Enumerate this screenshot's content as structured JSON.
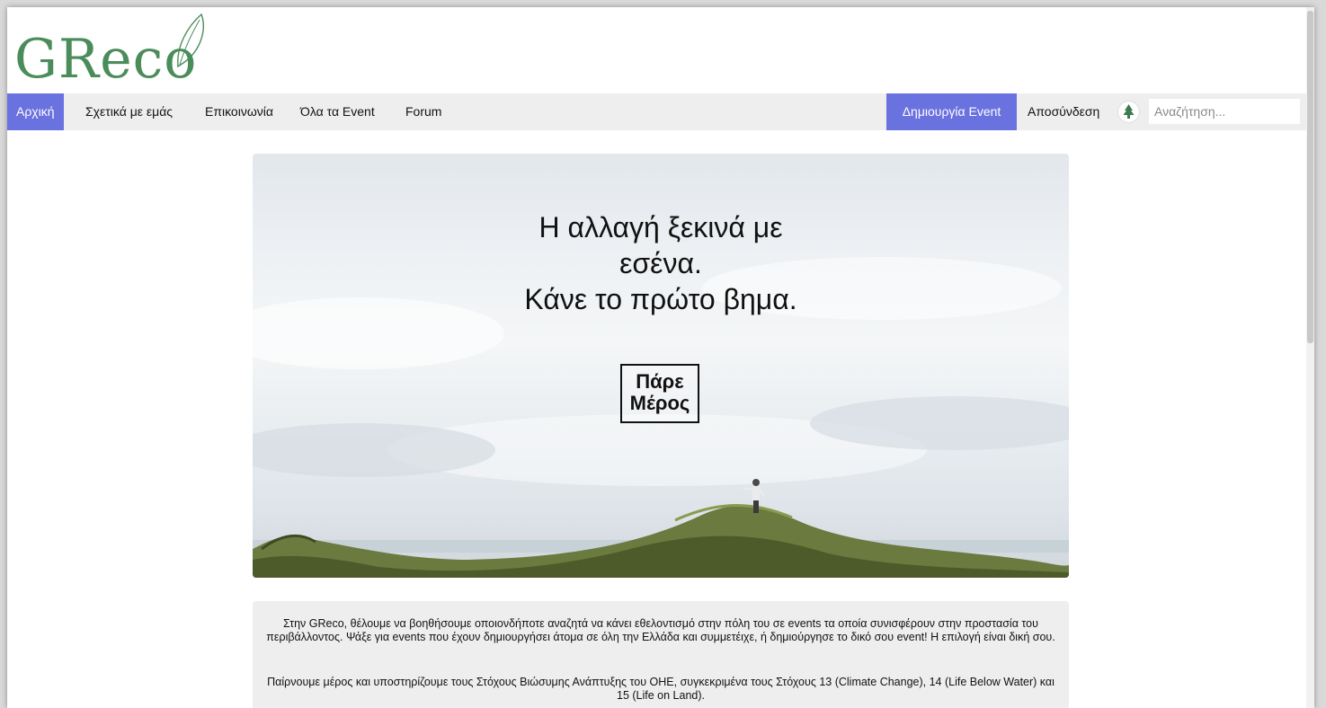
{
  "logo": {
    "text": "GReco"
  },
  "nav": {
    "items": [
      {
        "label": "Αρχική",
        "active": true
      },
      {
        "label": "Σχετικά με εμάς",
        "active": false
      },
      {
        "label": "Επικοινωνία",
        "active": false
      },
      {
        "label": "Όλα τα Event",
        "active": false
      },
      {
        "label": "Forum",
        "active": false
      }
    ],
    "create_event": "Δημιουργία Event",
    "logout": "Αποσύνδεση",
    "user_icon": "tree-icon",
    "search_placeholder": "Αναζήτηση..."
  },
  "hero": {
    "title_lines": [
      "Η αλλαγή ξεκινά με",
      "εσένα.",
      "Κάνε το πρώτο βημα."
    ],
    "button_lines": [
      "Πάρε",
      "Μέρος"
    ]
  },
  "about": {
    "paragraph1": "Στην GReco, θέλουμε να βοηθήσουμε οποιονδήποτε αναζητά να κάνει εθελοντισμό στην πόλη του σε events τα οποία συνισφέρουν στην προστασία του περιβάλλοντος. Ψάξε για events που έχουν δημιουργήσει άτομα σε όλη την Ελλάδα και συμμετέιχε, ή δημιούργησε το δικό σου event! Η επιλογή είναι δική σου.",
    "paragraph2": "Παίρνουμε μέρος και υποστηρίζουμε τους Στόχους Βιώσυμης Ανάπτυξης του ΟΗΕ, συγκεκριμένα τους Στόχους 13 (Climate Change), 14 (Life Below Water) και 15 (Life on Land)."
  },
  "colors": {
    "accent": "#6a72e0",
    "logo_green": "#4a8c5a",
    "navbar_bg": "#eeeeee"
  }
}
